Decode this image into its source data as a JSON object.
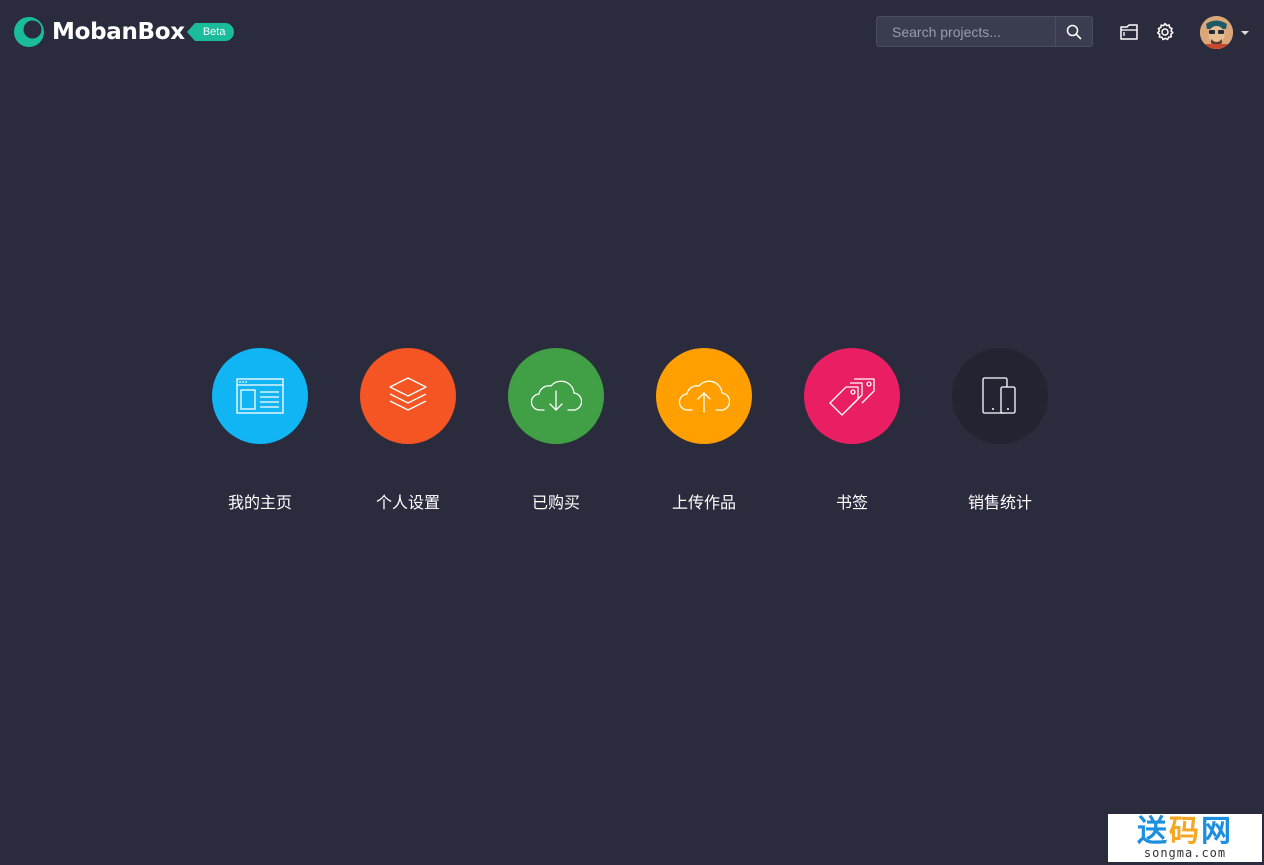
{
  "header": {
    "brand": "MobanBox",
    "badge": "Beta",
    "search_placeholder": "Search projects..."
  },
  "icons": {
    "search": "search-icon",
    "folder": "folder-icon",
    "settings": "gear-icon",
    "avatar": "user-avatar",
    "caret": "caret-down-icon"
  },
  "tiles": [
    {
      "label": "我的主页",
      "icon": "browser-window-icon",
      "color": "#11b5f3"
    },
    {
      "label": "个人设置",
      "icon": "layers-icon",
      "color": "#f55523"
    },
    {
      "label": "已购买",
      "icon": "cloud-download-icon",
      "color": "#41a046"
    },
    {
      "label": "上传作品",
      "icon": "cloud-upload-icon",
      "color": "#ffa000"
    },
    {
      "label": "书签",
      "icon": "tags-icon",
      "color": "#e91e63"
    },
    {
      "label": "销售统计",
      "icon": "devices-icon",
      "color": "#232431"
    }
  ],
  "watermark": {
    "name": "送码网",
    "url": "songma.com"
  },
  "colors": {
    "background": "#2a2b3d",
    "accent": "#1abc9c"
  }
}
